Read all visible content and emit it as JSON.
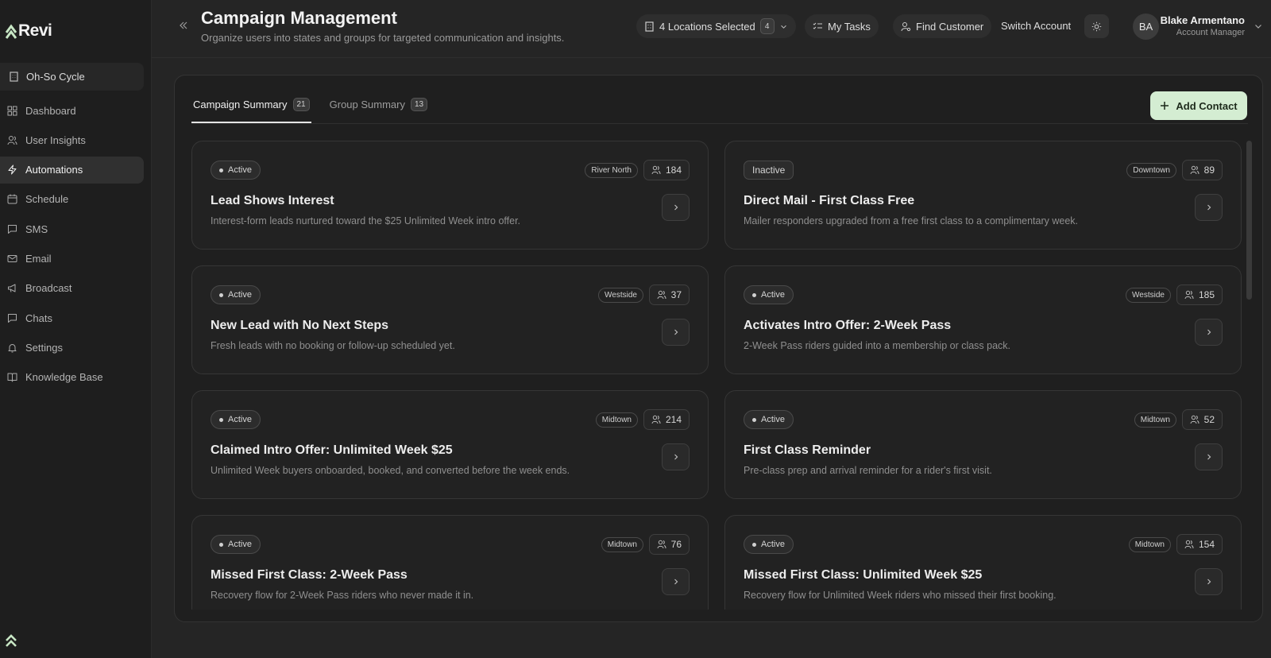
{
  "app": {
    "logo": "Revi"
  },
  "sidebar": {
    "org": "Oh-So Cycle",
    "items": [
      {
        "label": "Dashboard",
        "icon": "grid-icon"
      },
      {
        "label": "User Insights",
        "icon": "users-icon"
      },
      {
        "label": "Automations",
        "icon": "bolt-icon",
        "active": true
      },
      {
        "label": "Schedule",
        "icon": "calendar-icon"
      },
      {
        "label": "SMS",
        "icon": "message-icon"
      },
      {
        "label": "Email",
        "icon": "mail-icon"
      },
      {
        "label": "Broadcast",
        "icon": "megaphone-icon"
      },
      {
        "label": "Chats",
        "icon": "chat-icon"
      },
      {
        "label": "Settings",
        "icon": "bell-icon"
      },
      {
        "label": "Knowledge Base",
        "icon": "book-icon"
      }
    ]
  },
  "header": {
    "title": "Campaign Management",
    "subtitle": "Organize users into states and groups for targeted communication and insights.",
    "locations_label": "4 Locations Selected",
    "locations_count": "4",
    "my_tasks": "My Tasks",
    "find_customer": "Find Customer",
    "switch_account": "Switch Account",
    "user_initials": "BA",
    "user_name": "Blake Armentano",
    "user_role": "Account Manager"
  },
  "tabs": [
    {
      "label": "Campaign Summary",
      "count": "21",
      "active": true
    },
    {
      "label": "Group Summary",
      "count": "13",
      "active": false
    }
  ],
  "add_contact": "Add Contact",
  "colors": {
    "accent": "#d4edd2",
    "background": "#252525",
    "card": "#222222"
  },
  "campaigns": [
    {
      "status": "Active",
      "location": "River North",
      "members": "184",
      "title": "Lead Shows Interest",
      "description": "Interest-form leads nurtured toward the $25 Unlimited Week intro offer."
    },
    {
      "status": "Inactive",
      "location": "Downtown",
      "members": "89",
      "title": "Direct Mail - First Class Free",
      "description": "Mailer responders upgraded from a free first class to a complimentary week."
    },
    {
      "status": "Active",
      "location": "Westside",
      "members": "37",
      "title": "New Lead with No Next Steps",
      "description": "Fresh leads with no booking or follow-up scheduled yet."
    },
    {
      "status": "Active",
      "location": "Westside",
      "members": "185",
      "title": "Activates Intro Offer: 2-Week Pass",
      "description": "2-Week Pass riders guided into a membership or class pack."
    },
    {
      "status": "Active",
      "location": "Midtown",
      "members": "214",
      "title": "Claimed Intro Offer: Unlimited Week $25",
      "description": "Unlimited Week buyers onboarded, booked, and converted before the week ends."
    },
    {
      "status": "Active",
      "location": "Midtown",
      "members": "52",
      "title": "First Class Reminder",
      "description": "Pre-class prep and arrival reminder for a rider's first visit."
    },
    {
      "status": "Active",
      "location": "Midtown",
      "members": "76",
      "title": "Missed First Class: 2-Week Pass",
      "description": "Recovery flow for 2-Week Pass riders who never made it in."
    },
    {
      "status": "Active",
      "location": "Midtown",
      "members": "154",
      "title": "Missed First Class: Unlimited Week $25",
      "description": "Recovery flow for Unlimited Week riders who missed their first booking."
    }
  ]
}
